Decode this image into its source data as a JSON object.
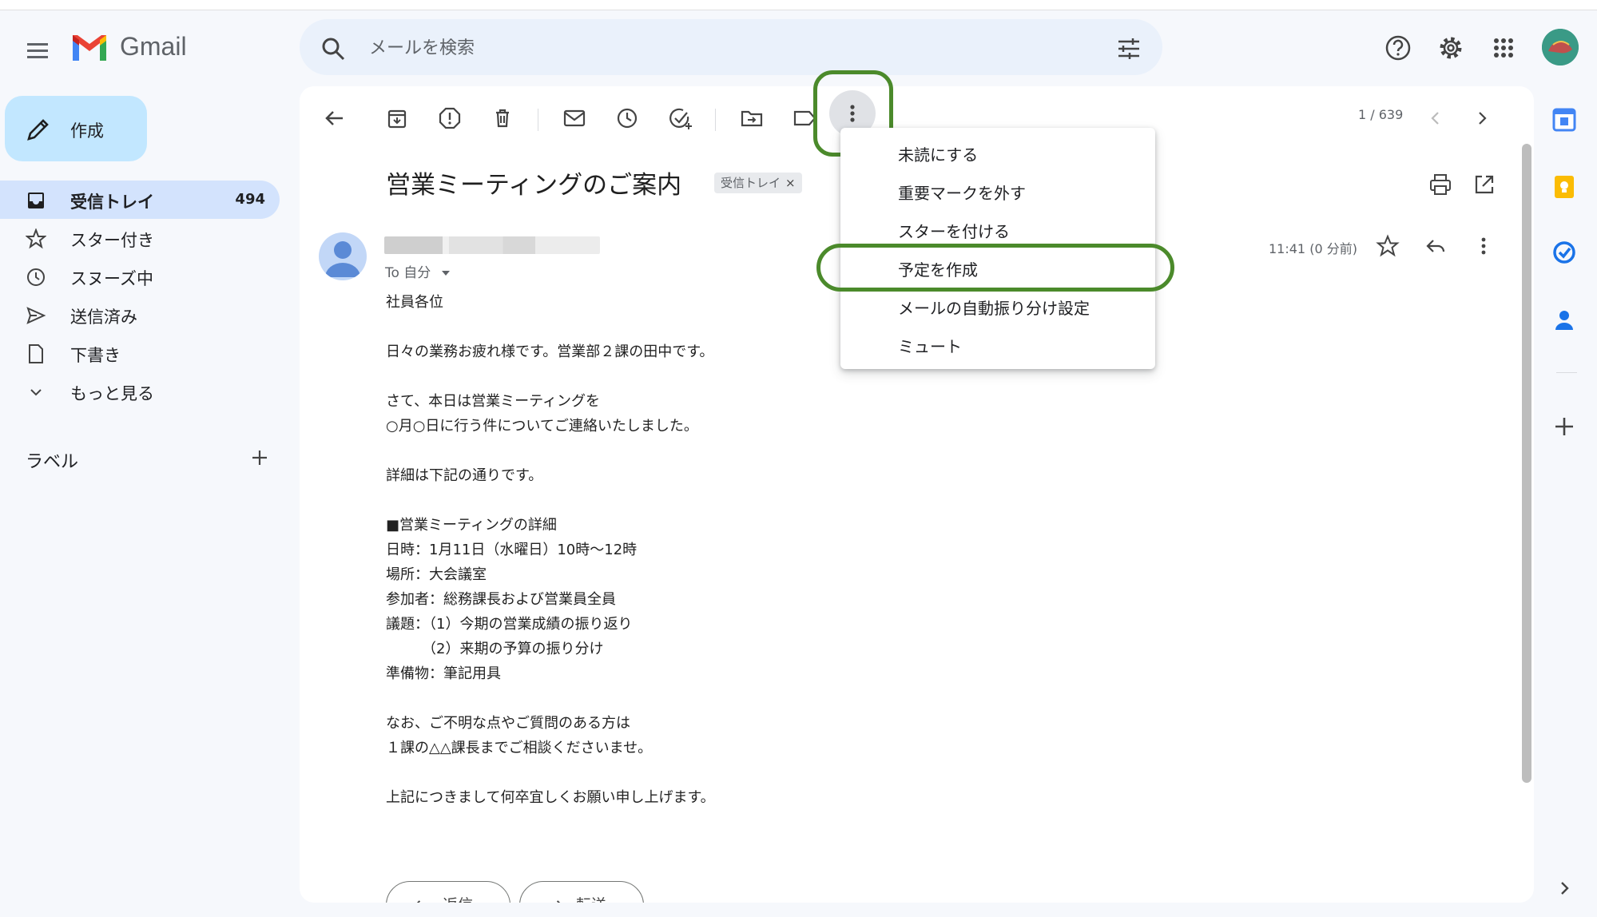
{
  "app": {
    "name": "Gmail"
  },
  "search": {
    "placeholder": "メールを検索"
  },
  "compose": {
    "label": "作成"
  },
  "sidebar": {
    "items": [
      {
        "label": "受信トレイ",
        "count": "494",
        "icon": "inbox-icon",
        "active": true
      },
      {
        "label": "スター付き",
        "icon": "star-icon"
      },
      {
        "label": "スヌーズ中",
        "icon": "clock-icon"
      },
      {
        "label": "送信済み",
        "icon": "send-icon"
      },
      {
        "label": "下書き",
        "icon": "draft-icon"
      },
      {
        "label": "もっと見る",
        "icon": "chevron-down-icon"
      }
    ],
    "labels_title": "ラベル"
  },
  "toolbar": {
    "pager": "1 / 639"
  },
  "email": {
    "subject": "営業ミーティングのご案内",
    "tag": "受信トレイ",
    "tag_close": "×",
    "to": "To 自分",
    "time": "11:41 (0 分前)",
    "body": [
      "社員各位",
      "",
      "日々の業務お疲れ様です。営業部２課の田中です。",
      "",
      "さて、本日は営業ミーティングを",
      "○月○日に行う件についてご連絡いたしました。",
      "",
      "詳細は下記の通りです。",
      "",
      "■営業ミーティングの詳細",
      "日時：1月11日（水曜日）10時〜12時",
      "場所：大会議室",
      "参加者：総務課長および営業員全員",
      "議題：（1）今期の営業成績の振り返り",
      "　　　（2）来期の予算の振り分け",
      "準備物：筆記用具",
      "",
      "なお、ご不明な点やご質問のある方は",
      "１課の△△課長までご相談くださいませ。",
      "",
      "上記につきまして何卒宜しくお願い申し上げます。"
    ],
    "reply_label": "返信",
    "forward_label": "転送"
  },
  "menu": {
    "items": [
      "未読にする",
      "重要マークを外す",
      "スターを付ける",
      "予定を作成",
      "メールの自動振り分け設定",
      "ミュート"
    ],
    "highlighted": "予定を作成"
  },
  "colors": {
    "highlight": "#4b8a2b",
    "compose": "#c2e7ff",
    "active_nav": "#d3e3fd"
  }
}
